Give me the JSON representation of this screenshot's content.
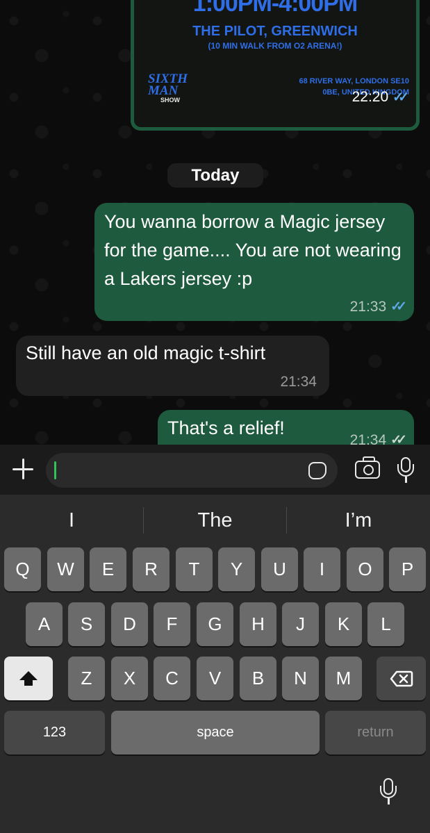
{
  "chat": {
    "flyer": {
      "time": "1:00PM-4:00PM",
      "venue": "THE PILOT, GREENWICH",
      "walk": "(10 MIN WALK FROM O2 ARENA!)",
      "logo_top": "SIXTH",
      "logo_mid": "MAN",
      "logo_sub": "SHOW",
      "address_line1": "68 RIVER WAY, LONDON SE10",
      "address_line2": "0BE, UNITED KINGDOM",
      "timestamp": "22:20",
      "status": "read"
    },
    "date_separator": "Today",
    "messages": [
      {
        "direction": "outgoing",
        "text": "You wanna borrow a Magic jersey for the game.... You are not wearing a Lakers jersey :p",
        "time": "21:33",
        "status": "read"
      },
      {
        "direction": "incoming",
        "text": "Still have an old magic t-shirt",
        "time": "21:34"
      },
      {
        "direction": "outgoing",
        "text": "That's a relief!",
        "time": "21:34",
        "status": "sent"
      }
    ]
  },
  "composer": {
    "input_value": "",
    "icons": [
      "plus-icon",
      "sticker-icon",
      "camera-icon",
      "microphone-icon"
    ]
  },
  "keyboard": {
    "suggestions": [
      "I",
      "The",
      "I’m"
    ],
    "row1": [
      "Q",
      "W",
      "E",
      "R",
      "T",
      "Y",
      "U",
      "I",
      "O",
      "P"
    ],
    "row2": [
      "A",
      "S",
      "D",
      "F",
      "G",
      "H",
      "J",
      "K",
      "L"
    ],
    "row3": [
      "Z",
      "X",
      "C",
      "V",
      "B",
      "N",
      "M"
    ],
    "numbers_label": "123",
    "space_label": "space",
    "return_label": "return"
  },
  "colors": {
    "outgoing_bubble": "#1e5a3e",
    "incoming_bubble": "#202020",
    "read_ticks": "#5fa8e8",
    "flyer_text": "#2f6ee6",
    "caret": "#33c35c"
  }
}
